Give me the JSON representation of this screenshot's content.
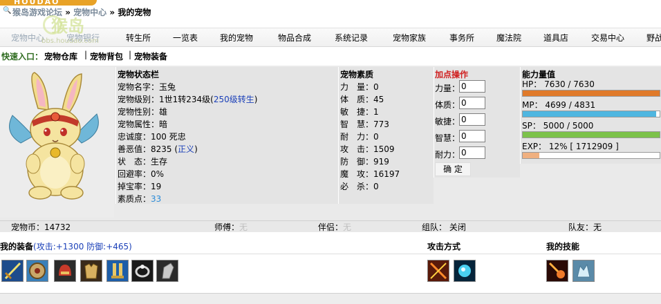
{
  "header": {
    "logo_text": "HOUDAO",
    "breadcrumb_forum": "猴岛游戏论坛",
    "breadcrumb_sep": "»",
    "breadcrumb_center": "宠物中心",
    "breadcrumb_current": "我的宠物"
  },
  "watermark": {
    "main": "猴岛",
    "url": "bbs.houdao.com"
  },
  "nav": {
    "items": [
      "宠物中心",
      "宠物银行",
      "转生所",
      "一览表",
      "我的宠物",
      "物品合成",
      "系统记录",
      "宠物家族",
      "事务所",
      "魔法院",
      "道具店",
      "交易中心",
      "野战"
    ]
  },
  "quick": {
    "label": "快速入口：",
    "links": [
      "宠物仓库",
      "宠物背包",
      "宠物装备"
    ],
    "sep": "|"
  },
  "status": {
    "title": "宠物状态栏",
    "name": "宠物名字：玉兔",
    "level_prefix": "宠物级别：1世1转234级(",
    "level_link": "250级转生",
    "level_suffix": ")",
    "gender": "宠物性别：雄",
    "attribute": "宠物属性：暗",
    "loyalty": "忠诚度：100 死忠",
    "karma_prefix": "善恶值：8235 (",
    "karma_link": "正义",
    "karma_suffix": ")",
    "state": "状　态：生存",
    "evade": "回避率：0%",
    "drop": "掉宝率：19",
    "points_label": "素质点：",
    "points_value": "33"
  },
  "attrs": {
    "title": "宠物素质",
    "rows": [
      "力　量：0",
      "体　质：45",
      "敏　捷：1",
      "智　慧：773",
      "耐　力：0",
      "攻　击：1509",
      "防　御：919",
      "魔　攻：16197",
      "必　杀：0"
    ]
  },
  "points": {
    "title": "加点操作",
    "labels": [
      "力量：",
      "体质：",
      "敏捷：",
      "智慧：",
      "耐力："
    ],
    "values": [
      "0",
      "0",
      "0",
      "0",
      "0"
    ],
    "confirm": "确 定"
  },
  "ability": {
    "title": "能力量值",
    "hp": "HP：  7630 / 7630",
    "mp": "MP：  4699 / 4831",
    "sp": "SP：  5000 / 5000",
    "exp": "EXP：  12% [ 1712909 ]",
    "hp_fraction": 1.0,
    "mp_fraction": 0.973,
    "sp_fraction": 1.0,
    "exp_fraction": 0.12,
    "hp_color": "#e07a2a",
    "mp_color": "#4fb6e0",
    "sp_color": "#7cc24a",
    "exp_color": "#f0b080"
  },
  "info": {
    "coins": "宠物币：14732",
    "master_label": "师傅：",
    "master_value": "无",
    "partner_label": "伴侣：",
    "partner_value": "无",
    "team": "组队：  关闭",
    "teammate": "队友：无"
  },
  "bottom": {
    "equip_label": "我的装备",
    "equip_stats": "(攻击:+1300 防御:+465)",
    "attack_title": "攻击方式",
    "skill_title": "我的技能",
    "equip_icons": [
      "sword-icon",
      "shield-icon",
      "helmet-icon",
      "armor-icon",
      "boots-icon",
      "ring-icon",
      "gauntlet-icon"
    ],
    "attack_icons": [
      "fire-slash-icon",
      "ice-orb-icon"
    ],
    "skill_icons": [
      "meteor-icon",
      "ice-beast-icon"
    ]
  }
}
